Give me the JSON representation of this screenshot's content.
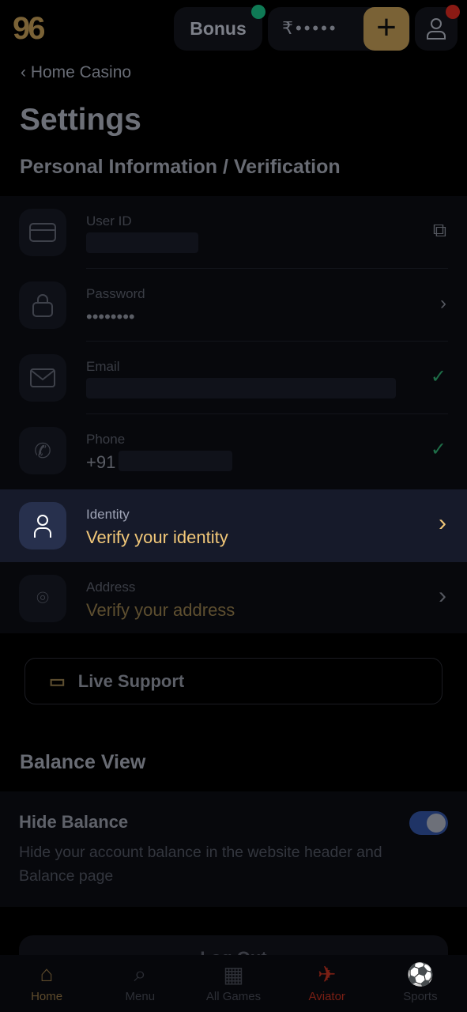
{
  "header": {
    "logo": "96",
    "bonus_label": "Bonus",
    "balance": "₹•••••",
    "add_label": "+",
    "bonus_dot_color": "#0f7a55",
    "user_dot_color": "#8a1a14"
  },
  "breadcrumb": {
    "back_label": "Home Casino"
  },
  "page_title": "Settings",
  "section_personal": "Personal Information / Verification",
  "rows": [
    {
      "label": "User ID",
      "value": "",
      "action": "copy-icon"
    },
    {
      "label": "Password",
      "value": "••••••••",
      "action": "chevron-right-icon"
    },
    {
      "label": "Email",
      "value": "",
      "action": "check-icon"
    },
    {
      "label": "Phone",
      "value": "+91",
      "action": "check-icon"
    },
    {
      "label": "Identity",
      "value": "Verify your identity",
      "action": "chevron-right-icon"
    },
    {
      "label": "Address",
      "value": "Verify your address",
      "action": "chevron-right-icon"
    }
  ],
  "live_support": "Live Support",
  "section_balance": "Balance View",
  "hide_balance": {
    "title": "Hide Balance",
    "description": "Hide your account balance in the website header and Balance page",
    "enabled": true
  },
  "logout_label": "Log Out",
  "nav": [
    {
      "label": "Home",
      "active": true
    },
    {
      "label": "Menu"
    },
    {
      "label": "All Games"
    },
    {
      "label": "Aviator"
    },
    {
      "label": "Sports"
    }
  ],
  "colors": {
    "accent": "#f2c879",
    "check": "#1e6e48",
    "aviator": "#7a1f14"
  }
}
